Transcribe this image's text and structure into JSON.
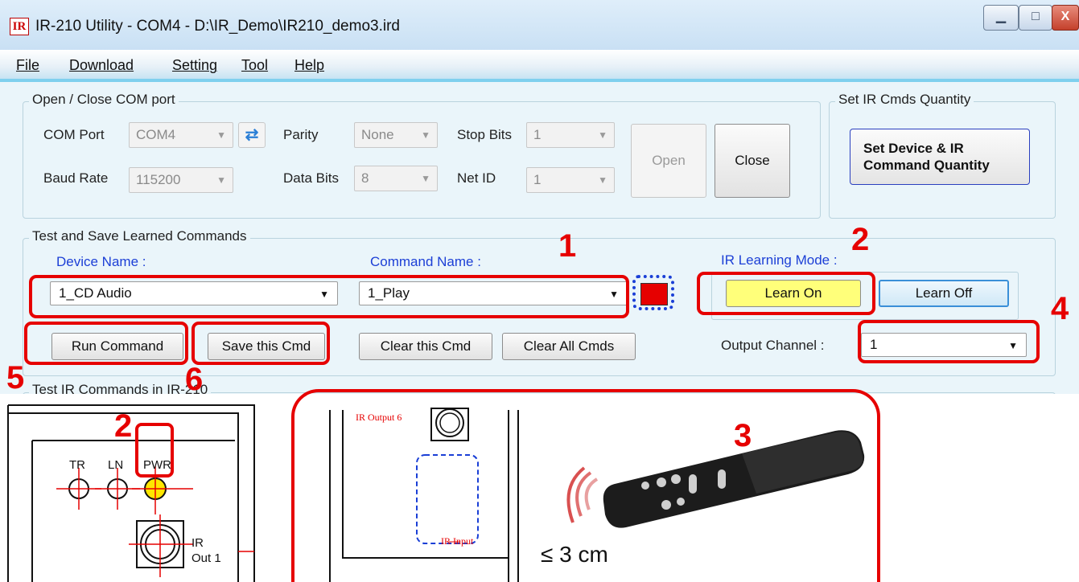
{
  "window": {
    "title": "IR-210 Utility - COM4 - D:\\IR_Demo\\IR210_demo3.ird",
    "icon_text": "IR",
    "min_glyph": "▁",
    "max_glyph": "□",
    "close_glyph": "X"
  },
  "menu": [
    "File",
    "Download",
    "Setting",
    "Tool",
    "Help"
  ],
  "com_group": {
    "title": "Open / Close COM port",
    "com_port_label": "COM Port",
    "com_port_value": "COM4",
    "parity_label": "Parity",
    "parity_value": "None",
    "stop_bits_label": "Stop Bits",
    "stop_bits_value": "1",
    "baud_rate_label": "Baud Rate",
    "baud_rate_value": "115200",
    "data_bits_label": "Data Bits",
    "data_bits_value": "8",
    "net_id_label": "Net ID",
    "net_id_value": "1",
    "open_label": "Open",
    "close_label": "Close"
  },
  "qty_group": {
    "title": "Set IR Cmds Quantity",
    "button_line1": "Set Device & IR",
    "button_line2": "Command Quantity"
  },
  "learn_group": {
    "title": "Test and Save Learned Commands",
    "device_name_label": "Device Name :",
    "device_name_value": "1_CD Audio",
    "command_name_label": "Command Name :",
    "command_name_value": "1_Play",
    "ir_learning_label": "IR Learning Mode :",
    "learn_on_label": "Learn On",
    "learn_off_label": "Learn Off",
    "run_command_label": "Run Command",
    "save_cmd_label": "Save this Cmd",
    "clear_cmd_label": "Clear this Cmd",
    "clear_all_label": "Clear All Cmds",
    "output_channel_label": "Output Channel :",
    "output_channel_value": "1",
    "indicator_color": "#e60000"
  },
  "test_group_title": "Test IR Commands in IR-210",
  "annotations": {
    "n1": "1",
    "n2": "2",
    "n3": "3",
    "n4": "4",
    "n5": "5",
    "n6": "6",
    "color": "#e60000"
  },
  "device_diagram": {
    "tr_label": "TR",
    "ln_label": "LN",
    "pwr_label": "PWR",
    "out1_label_line1": "IR",
    "out1_label_line2": "Out 1",
    "ir_output6_label": "IR Output 6",
    "ir_input_label": "IR Input",
    "distance_label": "≤ 3 cm",
    "pwr_led_color": "#ffe600"
  }
}
